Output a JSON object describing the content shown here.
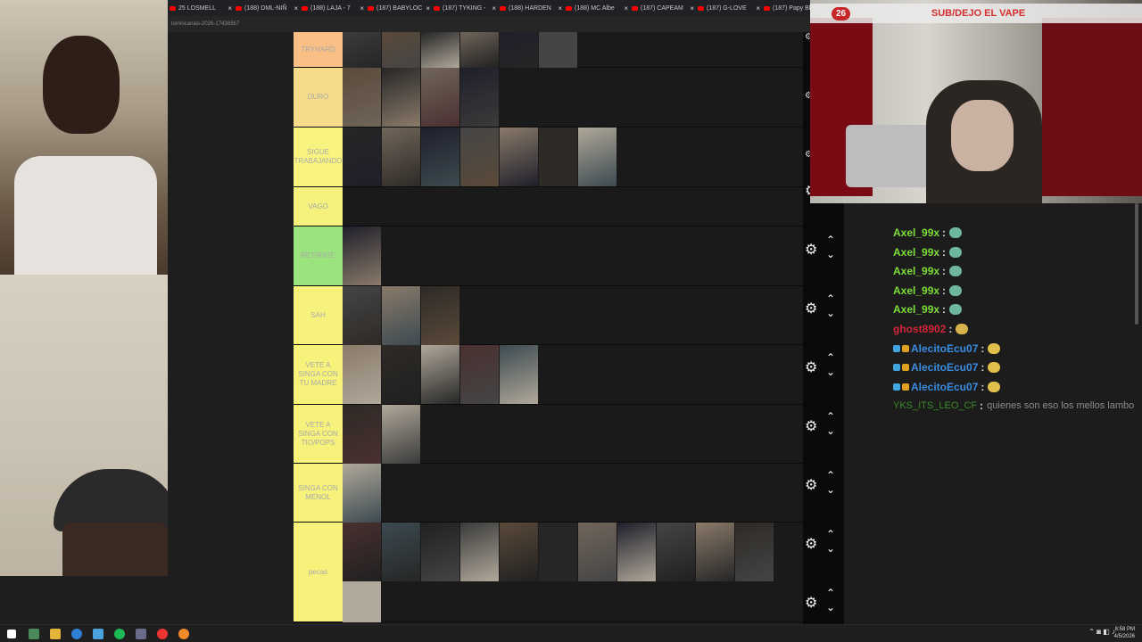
{
  "browser": {
    "tabs": [
      "25 LOSMELL",
      "(188) DML-NIÑ",
      "(188) LAJA - 7",
      "(187) BABYLOC",
      "(187) TYKING -",
      "(188) HARDEN",
      "(188) MC Albe",
      "(187) CAPEAM",
      "(187) G-LOVE",
      "(187) Papy Bl"
    ],
    "url": "tomnicanais-2026-17438367"
  },
  "tiers": [
    {
      "label": "TRYHARD",
      "color": "#f9bf84",
      "count": 6
    },
    {
      "label": "DURO",
      "color": "#f6dc8a",
      "count": 4
    },
    {
      "label": "SIGUE TRABAJANDO",
      "color": "#f8f47f",
      "count": 7
    },
    {
      "label": "VAGO",
      "color": "#f4f27d",
      "count": 0
    },
    {
      "label": "RETIRATE",
      "color": "#9be47d",
      "count": 1
    },
    {
      "label": "SAH",
      "color": "#f6f27c",
      "count": 3
    },
    {
      "label": "VETE A SINGA CON TU MADRE",
      "color": "#f6f27c",
      "count": 5
    },
    {
      "label": "VETE A SINGA CON TIO/POPS",
      "color": "#f6f27c",
      "count": 2
    },
    {
      "label": "SINGA CON MENOL",
      "color": "#f6f27c",
      "count": 1
    },
    {
      "label": "pecas",
      "color": "#f6f27c",
      "count": 12
    }
  ],
  "stream": {
    "live_count": "26",
    "title": "SUB/DEJO EL VAPE"
  },
  "chat": {
    "messages": [
      {
        "user": "Axel_99x",
        "user_color": "#7cdc3a",
        "text": ""
      },
      {
        "user": "Axel_99x",
        "user_color": "#7cdc3a",
        "text": ""
      },
      {
        "user": "Axel_99x",
        "user_color": "#7cdc3a",
        "text": ""
      },
      {
        "user": "Axel_99x",
        "user_color": "#7cdc3a",
        "text": ""
      },
      {
        "user": "Axel_99x",
        "user_color": "#7cdc3a",
        "text": ""
      },
      {
        "user": "ghost8902",
        "user_color": "#d3243a",
        "text": ""
      },
      {
        "user": "AlecitoEcu07",
        "user_color": "#3a8ce0",
        "text": ""
      },
      {
        "user": "AlecitoEcu07",
        "user_color": "#3a8ce0",
        "text": ""
      },
      {
        "user": "AlecitoEcu07",
        "user_color": "#3a8ce0",
        "text": ""
      },
      {
        "user": "YKS_ITS_LEO_CF",
        "user_color": "#3d8a2a",
        "text": "quienes son eso los mellos lambo"
      }
    ]
  },
  "taskbar": {
    "time": "8:58 PM",
    "date": "4/5/2026"
  }
}
